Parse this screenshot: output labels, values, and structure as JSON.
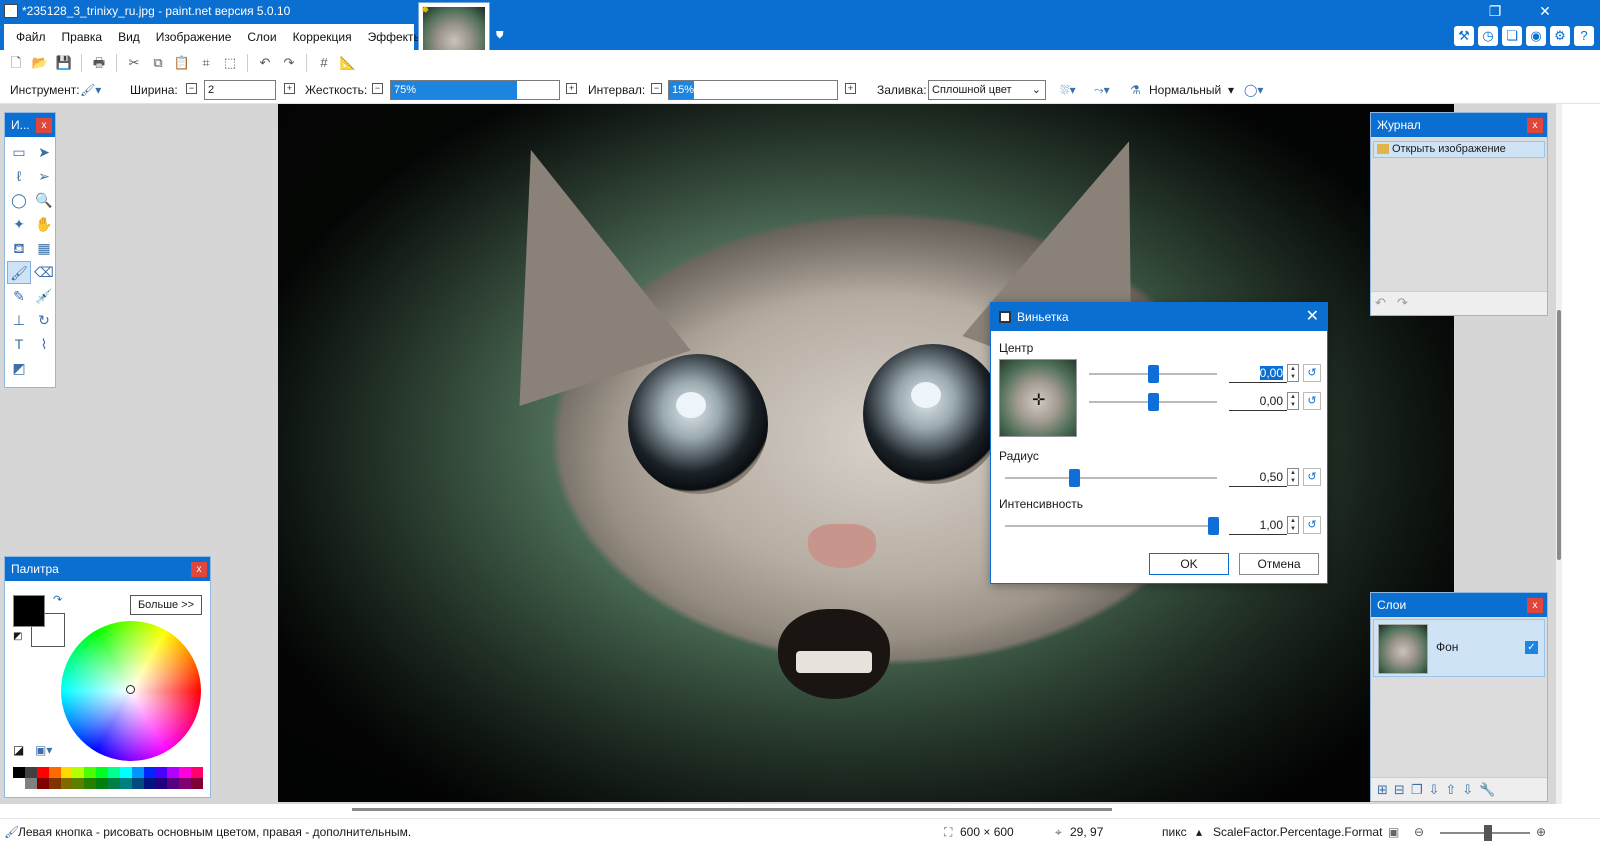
{
  "window": {
    "title": "*235128_3_trinixy_ru.jpg - paint.net версия 5.0.10",
    "minimize": "—",
    "restore": "❐",
    "close": "✕"
  },
  "menu": [
    "Файл",
    "Правка",
    "Вид",
    "Изображение",
    "Слои",
    "Коррекция",
    "Эффекты"
  ],
  "toolbar": {
    "tool_label": "Инструмент:",
    "width_label": "Ширина:",
    "width_value": "2",
    "hardness_label": "Жесткость:",
    "hardness_value": "75%",
    "hardness_fraction": 0.75,
    "interval_label": "Интервал:",
    "interval_value": "15%",
    "interval_fraction": 0.15,
    "fill_label": "Заливка:",
    "fill_value": "Сплошной цвет",
    "blend_value": "Нормальный"
  },
  "panels": {
    "tools_title": "И...",
    "palette_title": "Палитра",
    "palette_more": "Больше >>",
    "history_title": "Журнал",
    "history_item": "Открыть изображение",
    "layers_title": "Слои",
    "layer_name": "Фон"
  },
  "dialog": {
    "title": "Виньетка",
    "center_label": "Центр",
    "center_x": "0,00",
    "center_y": "0,00",
    "radius_label": "Радиус",
    "radius": "0,50",
    "intensity_label": "Интенсивность",
    "intensity": "1,00",
    "ok": "OK",
    "cancel": "Отмена"
  },
  "status": {
    "hint": "Левая кнопка - рисовать основным цветом, правая - дополнительным.",
    "size": "600 × 600",
    "cursor": "29, 97",
    "unit": "пикс",
    "scale": "ScaleFactor.Percentage.Format"
  },
  "colors": {
    "accent": "#0a6fd1",
    "primary": "#000000",
    "secondary": "#ffffff"
  }
}
